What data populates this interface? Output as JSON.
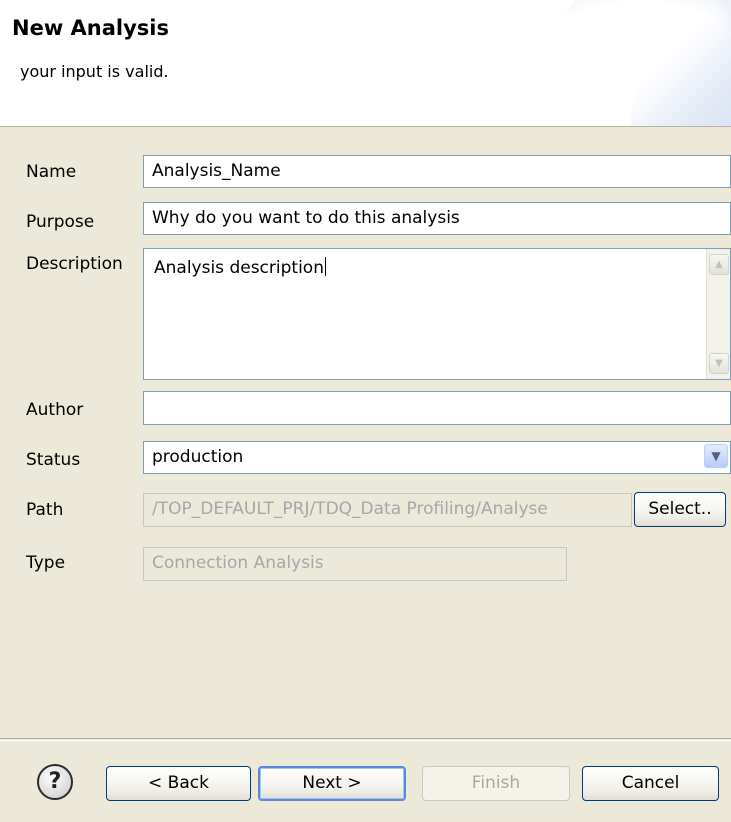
{
  "header": {
    "title": "New Analysis",
    "message": "your input is valid."
  },
  "form": {
    "name_label": "Name",
    "name_value": "Analysis_Name",
    "purpose_label": "Purpose",
    "purpose_value": "Why do you want to do this analysis",
    "description_label": "Description",
    "description_value": "Analysis description",
    "author_label": "Author",
    "author_value": "",
    "status_label": "Status",
    "status_value": "production",
    "path_label": "Path",
    "path_value": "/TOP_DEFAULT_PRJ/TDQ_Data Profiling/Analyse",
    "select_button": "Select..",
    "type_label": "Type",
    "type_value": "Connection Analysis"
  },
  "footer": {
    "help_icon": "?",
    "back": "< Back",
    "next": "Next >",
    "finish": "Finish",
    "cancel": "Cancel"
  },
  "icons": {
    "help": "help-icon",
    "dropdown": "chevron-down-icon",
    "scroll_up": "scroll-up-icon",
    "scroll_down": "scroll-down-icon"
  }
}
